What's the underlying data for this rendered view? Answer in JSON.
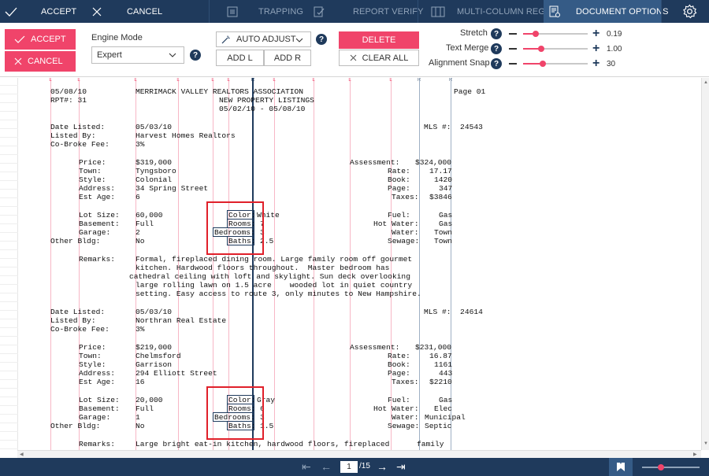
{
  "toolbar": {
    "accept": "ACCEPT",
    "cancel": "CANCEL",
    "trapping": "TRAPPING",
    "report_verify": "REPORT VERIFY",
    "multi_column": "MULTI-COLUMN REGION",
    "document_options": "DOCUMENT OPTIONS"
  },
  "panel": {
    "accept": "ACCEPT",
    "cancel": "CANCEL",
    "engine_mode_label": "Engine Mode",
    "engine_mode_value": "Expert",
    "auto_adjust": "AUTO ADJUST",
    "add_l": "ADD L",
    "add_r": "ADD R",
    "delete": "DELETE",
    "clear_all": "CLEAR ALL",
    "help": "?",
    "sliders": [
      {
        "label": "Stretch",
        "value": "0.19",
        "fraction": 0.19
      },
      {
        "label": "Text Merge",
        "value": "1.00",
        "fraction": 0.28
      },
      {
        "label": "Alignment Snap",
        "value": "30",
        "fraction": 0.3
      }
    ]
  },
  "document": {
    "column_marks": [
      "L",
      "L",
      "L",
      "L",
      "L",
      "L",
      "R",
      "L",
      "L",
      "L",
      "L",
      "R",
      "R"
    ],
    "lines": [
      {
        "col": 0,
        "text": "05/08/10"
      },
      {
        "col": 0,
        "text": "RPT#: 31"
      },
      {
        "col": 0,
        "text": ""
      },
      {
        "col": 0,
        "text": ""
      },
      {
        "col": 0,
        "text": "Date Listed:"
      },
      {
        "col": 0,
        "text": "Listed By:"
      },
      {
        "col": 0,
        "text": "Co-Broke Fee:"
      }
    ],
    "header_center": [
      "MERRIMACK VALLEY REALTORS ASSOCIATION",
      "NEW PROPERTY LISTINGS",
      "05/02/10 - 05/08/10"
    ],
    "page_label": "Page 01",
    "listings": [
      {
        "date_listed": "05/03/10",
        "listed_by": "Harvest Homes Realtors",
        "fee": "3%",
        "mls": "MLS #:  24543",
        "price": "$319,000",
        "town": "Tyngsboro",
        "style": "Colonial",
        "address": "34 Spring Street",
        "est_age": "6",
        "assessment": "$324,000",
        "rate": "17.17",
        "book": "1420",
        "page": "347",
        "taxes": "$3846",
        "lot_size": "60,000",
        "basement": "Full",
        "garage": "2",
        "other_bldg": "No",
        "color": "White",
        "rooms": "7",
        "bedrooms": "3",
        "baths": "2.5",
        "fuel": "Gas",
        "hot_water": "Gas",
        "water": "Town",
        "sewage": "Town",
        "remarks": [
          "Formal, fireplaced dining room. Large family room off gourmet",
          "kitchen. Hardwood floors throughout.  Master bedroom has",
          "cathedral ceiling with loft and skylight. Sun deck overlooking",
          "large rolling lawn on 1.5 acre    wooded lot in quiet country",
          "setting. Easy access to route 3, only minutes to New Hampshire."
        ]
      },
      {
        "date_listed": "05/03/10",
        "listed_by": "Northran Real Estate",
        "fee": "3%",
        "mls": "MLS #:  24614",
        "price": "$219,000",
        "town": "Chelmsford",
        "style": "Garrison",
        "address": "294 Elliott Street",
        "est_age": "16",
        "assessment": "$231,000",
        "rate": "16.87",
        "book": "1161",
        "page": "443",
        "taxes": "$2210",
        "lot_size": "20,000",
        "basement": "Full",
        "garage": "1",
        "other_bldg": "No",
        "color": "Gray",
        "rooms": "6",
        "bedrooms": "3",
        "baths": "1.5",
        "fuel": "Gas",
        "hot_water": "Elec",
        "water": "Municipal",
        "sewage": "Septic",
        "remarks": [
          "Large bright eat-in kitchen, hardwood floors, fireplaced      family"
        ]
      }
    ]
  },
  "labels": {
    "date_listed": "Date Listed:",
    "listed_by": "Listed By:",
    "fee": "Co-Broke Fee:",
    "price": "Price:",
    "town": "Town:",
    "style": "Style:",
    "address": "Address:",
    "est_age": "Est Age:",
    "assessment": "Assessment:",
    "rate": "Rate:",
    "book": "Book:",
    "page": "Page:",
    "taxes": "Taxes:",
    "lot_size": "Lot Size:",
    "basement": "Basement:",
    "garage": "Garage:",
    "other_bldg": "Other Bldg:",
    "color": "Color:",
    "rooms": "Rooms:",
    "bedrooms": "Bedrooms:",
    "baths": "Baths:",
    "fuel": "Fuel:",
    "hot_water": "Hot Water:",
    "water": "Water:",
    "sewage": "Sewage:",
    "remarks": "Remarks:"
  },
  "pager": {
    "current": "1",
    "total": "/15"
  },
  "colors": {
    "navy": "#1f3a5c",
    "accent": "#f0446a",
    "highlight": "#e0202a"
  }
}
